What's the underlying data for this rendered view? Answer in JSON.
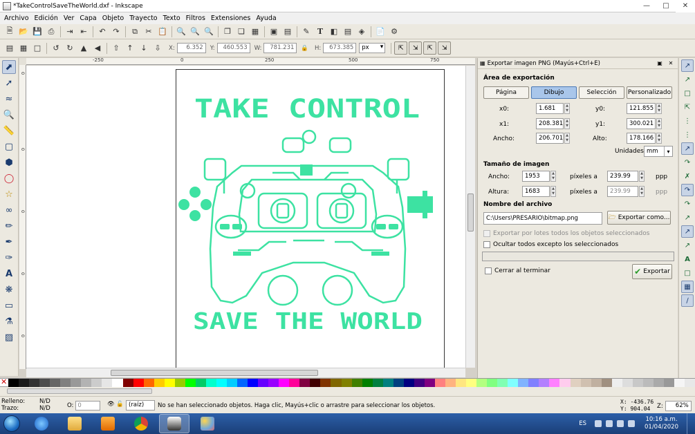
{
  "window": {
    "title": "*TakeControlSaveTheWorld.dxf - Inkscape"
  },
  "menu": [
    "Archivo",
    "Edición",
    "Ver",
    "Capa",
    "Objeto",
    "Trayecto",
    "Texto",
    "Filtros",
    "Extensiones",
    "Ayuda"
  ],
  "toolbar2": {
    "x_label": "X:",
    "x": "6.352",
    "y_label": "Y:",
    "y": "460.553",
    "w_label": "W:",
    "w": "781.231",
    "h_label": "H:",
    "h": "673.385",
    "unit": "px"
  },
  "ruler": {
    "top": [
      "-250",
      "0",
      "250",
      "500",
      "750"
    ],
    "left": [
      "0",
      "0",
      "0",
      "0",
      "0"
    ]
  },
  "artwork": {
    "line1": "TAKE CONTROL",
    "line2": "SAVE THE WORLD",
    "color": "#3de2a2"
  },
  "dialog": {
    "title": "Exportar imagen PNG (Mayús+Ctrl+E)",
    "area_heading": "Área de exportación",
    "tabs": [
      "Página",
      "Dibujo",
      "Selección",
      "Personalizado"
    ],
    "active_tab": 1,
    "x0_label": "x0:",
    "x0": "1.681",
    "y0_label": "y0:",
    "y0": "121.855",
    "x1_label": "x1:",
    "x1": "208.381",
    "y1_label": "y1:",
    "y1": "300.021",
    "ancho_label": "Ancho:",
    "ancho": "206.701",
    "alto_label": "Alto:",
    "alto": "178.166",
    "units_label": "Unidades:",
    "units": "mm",
    "size_heading": "Tamaño de imagen",
    "img_ancho_label": "Ancho:",
    "img_ancho": "1953",
    "img_altura_label": "Altura:",
    "img_altura": "1683",
    "px_at": "píxeles a",
    "dpi_x": "239.99",
    "dpi_y": "239.99",
    "ppp": "ppp",
    "file_heading": "Nombre del archivo",
    "filename": "C:\\Users\\PRESARIO\\bitmap.png",
    "export_as": "Exportar como...",
    "batch_label": "Exportar por lotes todos los objetos seleccionados",
    "hide_label": "Ocultar todos excepto los seleccionados",
    "close_label": "Cerrar al terminar",
    "export_btn": "Exportar"
  },
  "palette": [
    "#000000",
    "#1a1a1a",
    "#333333",
    "#4d4d4d",
    "#666666",
    "#808080",
    "#999999",
    "#b3b3b3",
    "#cccccc",
    "#e6e6e6",
    "#ffffff",
    "#800000",
    "#ff0000",
    "#ff6600",
    "#ffcc00",
    "#ffff00",
    "#99cc00",
    "#00ff00",
    "#00cc66",
    "#00ffcc",
    "#00ffff",
    "#00ccff",
    "#0066ff",
    "#0000ff",
    "#6600ff",
    "#9900ff",
    "#ff00ff",
    "#ff0099",
    "#800040",
    "#400000",
    "#803300",
    "#806600",
    "#808000",
    "#408000",
    "#008000",
    "#008040",
    "#008080",
    "#004080",
    "#000080",
    "#400080",
    "#800080",
    "#ff8080",
    "#ffb380",
    "#ffe680",
    "#ffff80",
    "#b3ff80",
    "#80ff80",
    "#80ffb3",
    "#80ffff",
    "#80b3ff",
    "#8080ff",
    "#b380ff",
    "#ff80ff",
    "#ffccee",
    "#e0d0c0",
    "#d0c0b0",
    "#c0b0a0",
    "#a09080",
    "#eeeeee",
    "#dddddd",
    "#c8c8c8",
    "#bbbbbb",
    "#aaaaaa",
    "#999999",
    "#f5f5f5",
    "#e8e8e8"
  ],
  "status": {
    "fill_label": "Relleno:",
    "fill": "N/D",
    "stroke_label": "Trazo:",
    "stroke": "N/D",
    "opacity_label": "O:",
    "opacity": "0",
    "layer": "(raíz)",
    "message": "No se han seleccionado objetos. Haga clic, Mayús+clic o arrastre para seleccionar los objetos.",
    "x_coord": "X: -436.76",
    "y_coord": "Y:  904.04",
    "zoom_label": "Z:",
    "zoom": "62%"
  },
  "taskbar": {
    "lang": "ES",
    "time": "10:16 a.m.",
    "date": "01/04/2020"
  }
}
